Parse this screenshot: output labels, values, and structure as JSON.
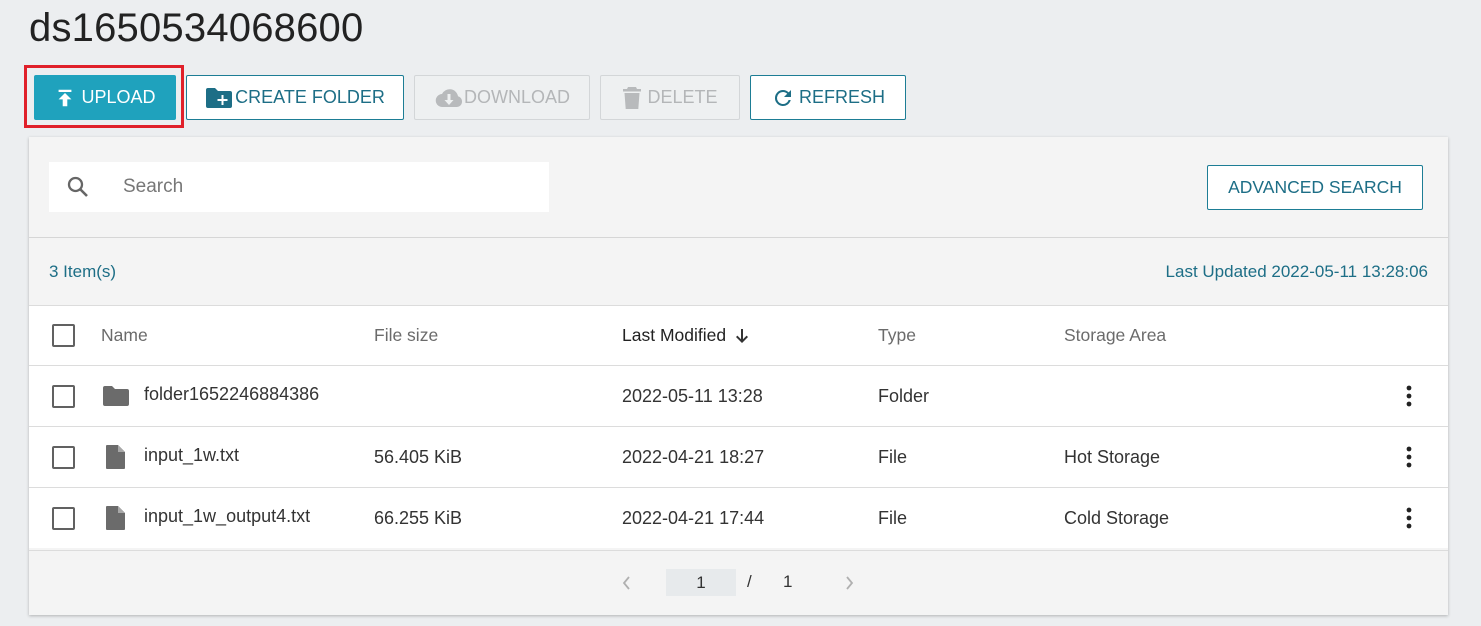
{
  "page": {
    "title": "ds1650534068600"
  },
  "toolbar": {
    "upload_label": "UPLOAD",
    "create_folder_label": "CREATE FOLDER",
    "download_label": "DOWNLOAD",
    "delete_label": "DELETE",
    "refresh_label": "REFRESH"
  },
  "search": {
    "placeholder": "Search",
    "advanced_label": "ADVANCED SEARCH"
  },
  "summary": {
    "items": "3 Item(s)",
    "last_updated": "Last Updated 2022-05-11 13:28:06"
  },
  "table": {
    "columns": {
      "name": "Name",
      "size": "File size",
      "modified": "Last Modified",
      "type": "Type",
      "area": "Storage Area"
    },
    "rows": [
      {
        "icon": "folder-icon",
        "name": "folder1652246884386",
        "size": "",
        "modified": "2022-05-11 13:28",
        "type": "Folder",
        "area": ""
      },
      {
        "icon": "file-icon",
        "name": "input_1w.txt",
        "size": "56.405 KiB",
        "modified": "2022-04-21 18:27",
        "type": "File",
        "area": "Hot Storage"
      },
      {
        "icon": "file-icon",
        "name": "input_1w_output4.txt",
        "size": "66.255 KiB",
        "modified": "2022-04-21 17:44",
        "type": "File",
        "area": "Cold Storage"
      }
    ]
  },
  "pagination": {
    "current": "1",
    "separator": "/",
    "total": "1"
  },
  "icons": {
    "upload": "upload-icon",
    "create_folder": "create-folder-icon",
    "download": "cloud-download-icon",
    "delete": "trash-icon",
    "refresh": "refresh-icon",
    "search": "search-icon",
    "sort": "arrow-down-icon",
    "row_menu": "more-vertical-icon"
  },
  "colors": {
    "accent": "#1fa2bd",
    "link": "#1d6e86",
    "highlight": "#e0202a"
  }
}
